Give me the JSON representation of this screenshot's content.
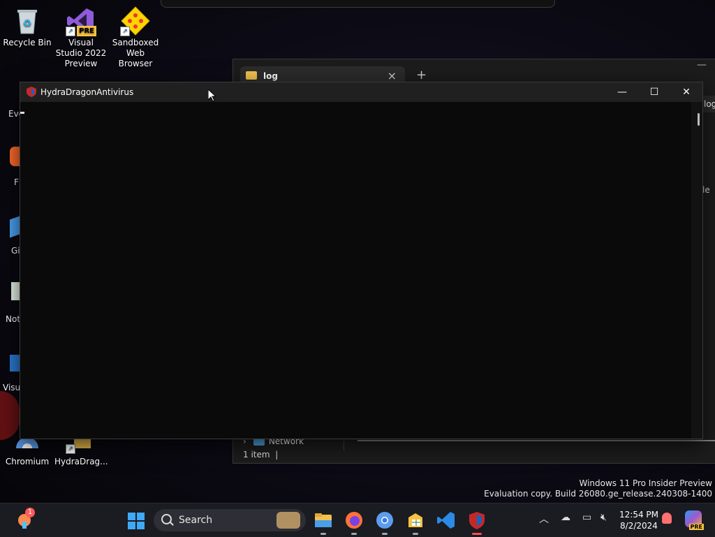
{
  "desktop": {
    "icons": [
      {
        "label": "Recycle Bin"
      },
      {
        "label": "Visual Studio 2022 Preview",
        "badge": "PRE"
      },
      {
        "label": "Sandboxed Web Browser"
      },
      {
        "label": "Chromium"
      },
      {
        "label": "HydraDrag..."
      }
    ],
    "partial_labels": [
      "Eve",
      "F",
      "Gi",
      "Not",
      "Visu"
    ]
  },
  "explorer": {
    "tab_label": "log",
    "crumb_right": "log",
    "right_text": "le",
    "nav_network": "Network",
    "status": "1 item"
  },
  "app": {
    "title": "HydraDragonAntivirus",
    "buttons": {
      "minimize": "—",
      "maximize": "☐",
      "close": "✕"
    }
  },
  "watermark": {
    "line1": "Windows 11 Pro Insider Preview",
    "line2": "Evaluation copy. Build 26080.ge_release.240308-1400"
  },
  "taskbar": {
    "search_label": "Search",
    "widget_badge": "1",
    "time": "12:54 PM",
    "date": "8/2/2024",
    "copilot_badge": "PRE"
  },
  "colors": {
    "accent": "#3fa9f5",
    "app_bg": "#0a0a0a",
    "titlebar": "#202020"
  }
}
